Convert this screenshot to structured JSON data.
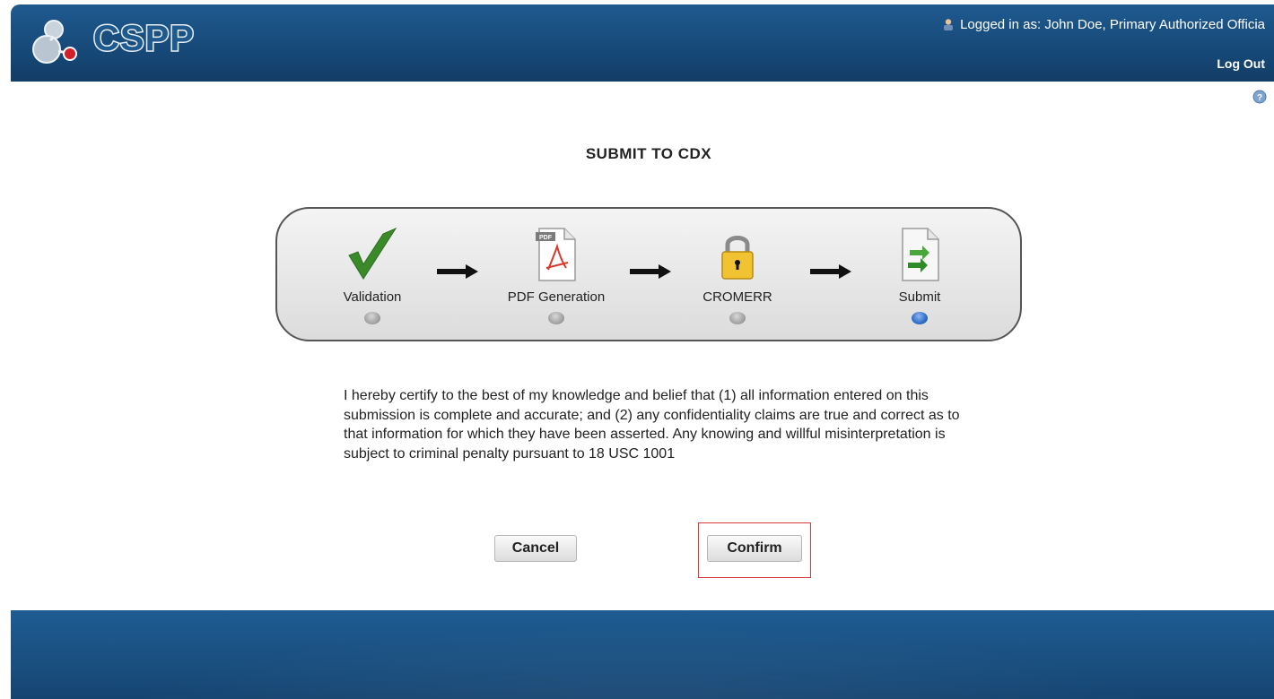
{
  "header": {
    "logo_text": "CSPP",
    "logged_in_as": "Logged in as: John Doe, Primary Authorized Officia",
    "logout_label": "Log Out"
  },
  "page": {
    "title": "SUBMIT TO CDX"
  },
  "steps": [
    {
      "label": "Validation",
      "icon": "checkmark-icon",
      "active": false
    },
    {
      "label": "PDF Generation",
      "icon": "pdf-document-icon",
      "active": false
    },
    {
      "label": "CROMERR",
      "icon": "padlock-icon",
      "active": false
    },
    {
      "label": "Submit",
      "icon": "submit-document-icon",
      "active": true
    }
  ],
  "certification": {
    "text": "I hereby certify to the best of my knowledge and belief that (1) all information entered on this submission is complete and accurate; and (2) any confidentiality claims are true and correct as to that information for which they have been asserted. Any knowing and willful misinterpretation is subject to criminal penalty pursuant to 18 USC 1001"
  },
  "buttons": {
    "cancel_label": "Cancel",
    "confirm_label": "Confirm"
  },
  "colors": {
    "header_blue": "#1f5a8f",
    "active_step": "#2e6cc7",
    "highlight_red": "#d43a3a"
  }
}
